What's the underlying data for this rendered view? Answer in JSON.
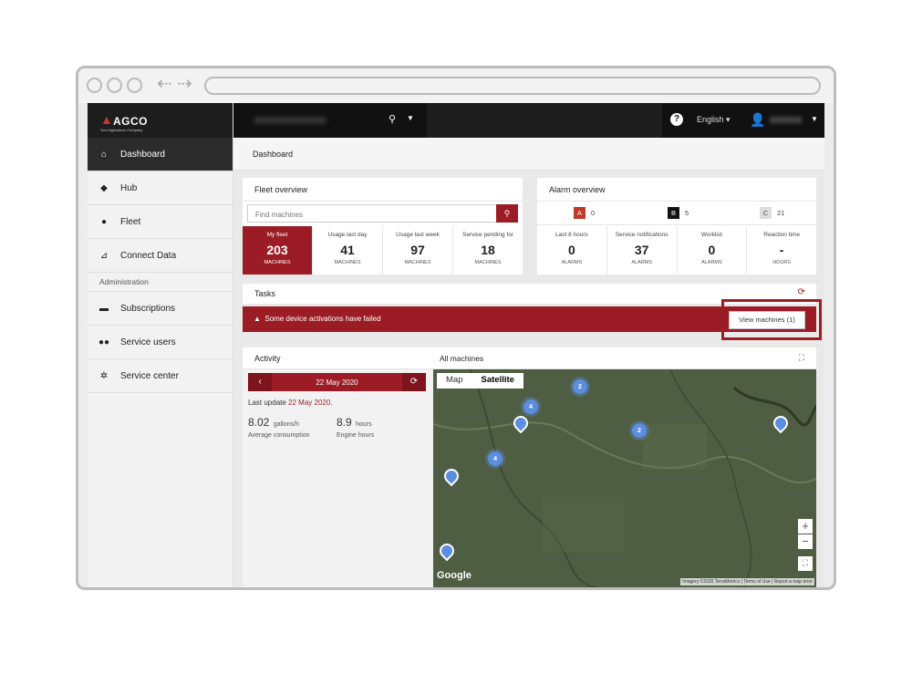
{
  "brand": {
    "name": "AGCO",
    "tagline": "Your Agriculture Company"
  },
  "topbar": {
    "language": "English"
  },
  "sidebar": {
    "items": [
      {
        "label": "Dashboard",
        "icon": "home-icon"
      },
      {
        "label": "Hub",
        "icon": "bell-icon"
      },
      {
        "label": "Fleet",
        "icon": "tractor-icon"
      },
      {
        "label": "Connect Data",
        "icon": "chart-icon"
      }
    ],
    "section": "Administration",
    "admin_items": [
      {
        "label": "Subscriptions",
        "icon": "card-icon"
      },
      {
        "label": "Service users",
        "icon": "users-icon"
      },
      {
        "label": "Service center",
        "icon": "gear-icon"
      }
    ]
  },
  "breadcrumb": "Dashboard",
  "fleet": {
    "title": "Fleet overview",
    "search_placeholder": "Find machines",
    "stats": [
      {
        "label": "My fleet",
        "value": "203",
        "unit": "MACHINES"
      },
      {
        "label": "Usage last day",
        "value": "41",
        "unit": "MACHINES"
      },
      {
        "label": "Usage last week",
        "value": "97",
        "unit": "MACHINES"
      },
      {
        "label": "Service pending for",
        "value": "18",
        "unit": "MACHINES"
      }
    ]
  },
  "alarm": {
    "title": "Alarm overview",
    "severity": [
      {
        "badge": "A",
        "count": "0",
        "color": "#c0392b"
      },
      {
        "badge": "B",
        "count": "5",
        "color": "#111111"
      },
      {
        "badge": "C",
        "count": "21",
        "color": "#dddddd"
      }
    ],
    "stats": [
      {
        "label": "Last 8 hours",
        "value": "0",
        "unit": "ALARMS"
      },
      {
        "label": "Service notifications",
        "value": "37",
        "unit": "ALARMS"
      },
      {
        "label": "Worklist",
        "value": "0",
        "unit": "ALARMS"
      },
      {
        "label": "Reaction time",
        "value": "-",
        "unit": "HOURS"
      }
    ]
  },
  "tasks": {
    "title": "Tasks",
    "alert": "Some device activations have failed",
    "button": "View machines (1)"
  },
  "activity": {
    "title": "Activity",
    "map_title": "All machines",
    "date": "22 May 2020",
    "last_update_label": "Last update",
    "last_update_date": "22 May 2020",
    "consumption_value": "8.02",
    "consumption_unit": "gallons/h",
    "consumption_label": "Average consumption",
    "hours_value": "8.9",
    "hours_unit": "hours",
    "hours_label": "Engine hours"
  },
  "map": {
    "tab_map": "Map",
    "tab_satellite": "Satellite",
    "clusters": [
      "4",
      "2",
      "4",
      "2"
    ],
    "google": "Google",
    "attribution": "Imagery ©2020 TerraMetrics | Terms of Use | Report a map error"
  },
  "colors": {
    "accent": "#9b1c24",
    "dark": "#1d1d1d"
  }
}
